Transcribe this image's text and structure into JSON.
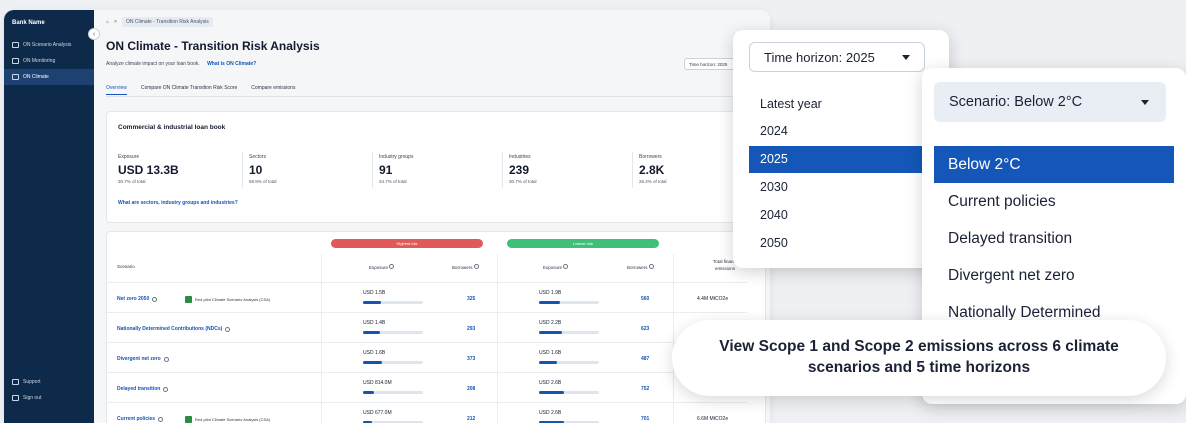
{
  "sidebar": {
    "bank_name": "Bank Name",
    "items": [
      {
        "label": "ON Scenario Analysis",
        "icon": "globe-icon"
      },
      {
        "label": "ON Monitoring",
        "icon": "monitor-icon"
      },
      {
        "label": "ON Climate",
        "icon": "leaf-icon"
      }
    ],
    "bottom": [
      {
        "label": "Support",
        "icon": "chat-icon"
      },
      {
        "label": "Sign out",
        "icon": "logout-icon"
      }
    ]
  },
  "breadcrumb": {
    "home_icon": "home-icon",
    "separator": ">",
    "current": "ON Climate - Transition Risk Analysis"
  },
  "page": {
    "title": "ON Climate - Transition Risk Analysis",
    "subtitle": "Analyze climate impact on your loan book.",
    "subtitle_link": "What is ON Climate?",
    "time_horizon_button": "Time horizon: 2025"
  },
  "tabs": [
    "Overview",
    "Compare ON Climate Transition Risk Score",
    "Compare emissions"
  ],
  "summary": {
    "title": "Commercial & industrial loan book",
    "stats": [
      {
        "label": "Exposure",
        "value": "USD 13.3B",
        "sub": "30.7% of total"
      },
      {
        "label": "Sectors",
        "value": "10",
        "sub": "58.8% of total"
      },
      {
        "label": "Industry groups",
        "value": "91",
        "sub": "34.7% of total"
      },
      {
        "label": "Industries",
        "value": "239",
        "sub": "30.7% of total"
      },
      {
        "label": "Borrowers",
        "value": "2.8K",
        "sub": "26.2% of total"
      }
    ],
    "link": "What are sectors, industry groups and industries?"
  },
  "table": {
    "highest_risk": "Highest risk",
    "lowest_risk": "Lowest risk",
    "headers": {
      "scenario": "Scenario",
      "exposure": "Exposure",
      "borrowers": "Borrowers",
      "total": "Total financ. emissions"
    },
    "rows": [
      {
        "scenario": "Net zero 2050",
        "source": "Red pilot Climate Scenario Analysis (CSA)",
        "high_exposure": "USD 1.5B",
        "high_fill": 0.3,
        "high_borrowers": "325",
        "low_exposure": "USD 1.9B",
        "low_fill": 0.35,
        "low_borrowers": "560",
        "total": "4.4M MtCO2e"
      },
      {
        "scenario": "Nationally Determined Contributions (NDCs)",
        "source": "",
        "high_exposure": "USD 1.4B",
        "high_fill": 0.28,
        "high_borrowers": "293",
        "low_exposure": "USD 2.2B",
        "low_fill": 0.38,
        "low_borrowers": "623",
        "total": ""
      },
      {
        "scenario": "Divergent net zero",
        "source": "",
        "high_exposure": "USD 1.6B",
        "high_fill": 0.32,
        "high_borrowers": "373",
        "low_exposure": "USD 1.6B",
        "low_fill": 0.3,
        "low_borrowers": "487",
        "total": ""
      },
      {
        "scenario": "Delayed transition",
        "source": "",
        "high_exposure": "USD 814.0M",
        "high_fill": 0.18,
        "high_borrowers": "208",
        "low_exposure": "USD 2.6B",
        "low_fill": 0.42,
        "low_borrowers": "752",
        "total": ""
      },
      {
        "scenario": "Current policies",
        "source": "Red pilot Climate Scenario Analysis (CSA)",
        "high_exposure": "USD 677.0M",
        "high_fill": 0.15,
        "high_borrowers": "212",
        "low_exposure": "USD 2.6B",
        "low_fill": 0.42,
        "low_borrowers": "701",
        "total": "6.6M MtCO2e"
      }
    ]
  },
  "time_dropdown": {
    "button": "Time horizon: 2025",
    "options": [
      "Latest year",
      "2024",
      "2025",
      "2030",
      "2040",
      "2050"
    ],
    "selected": "2025"
  },
  "scenario_dropdown": {
    "button": "Scenario: Below 2°C",
    "options": [
      "Below 2°C",
      "Current policies",
      "Delayed transition",
      "Divergent net zero",
      "Nationally Determined"
    ],
    "selected": "Below 2°C"
  },
  "callout": "View Scope 1 and Scope 2 emissions across 6 climate scenarios and 5 time horizons",
  "colors": {
    "sidebar": "#0e2a4a",
    "accent": "#1553b6",
    "highest_risk": "#e05a5a",
    "lowest_risk": "#3fbf7a",
    "selected_option": "#1557b8"
  }
}
